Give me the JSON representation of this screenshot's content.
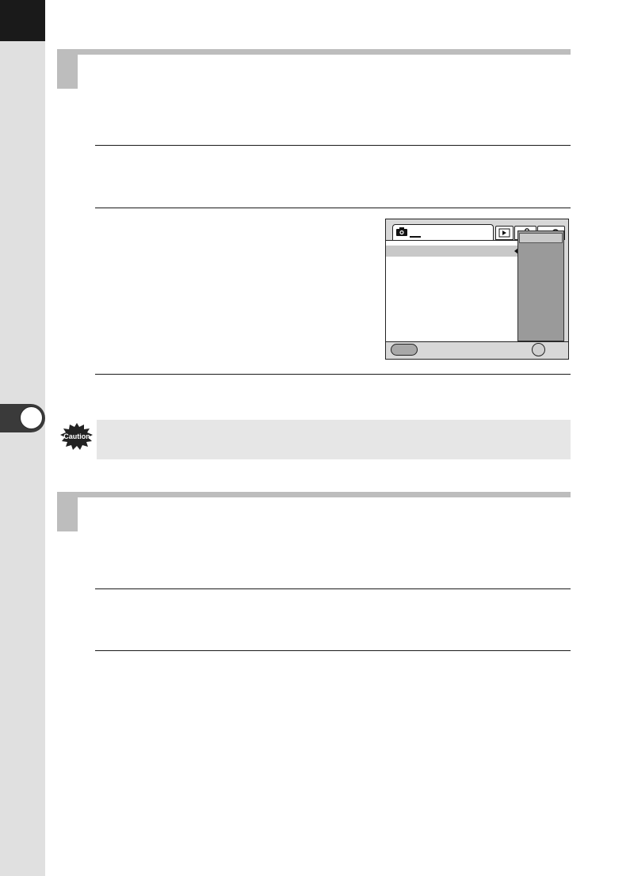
{
  "page": {
    "chapter_number": "",
    "sections": [
      {
        "title": ""
      },
      {
        "title": ""
      }
    ]
  },
  "camera_menu": {
    "tabs": {
      "shooting_icon": "camera-icon",
      "playback_icon": "play-icon",
      "setup_icon": "wrench-icon",
      "custom_icon": "custom-icon"
    }
  },
  "caution": {
    "badge_text": "Caution",
    "text": ""
  },
  "colors": {
    "sidebar": "#e0e0e0",
    "section_bar": "#bdbdbd",
    "caution_bg": "#e6e6e6",
    "dropdown": "#9a9a9a"
  }
}
